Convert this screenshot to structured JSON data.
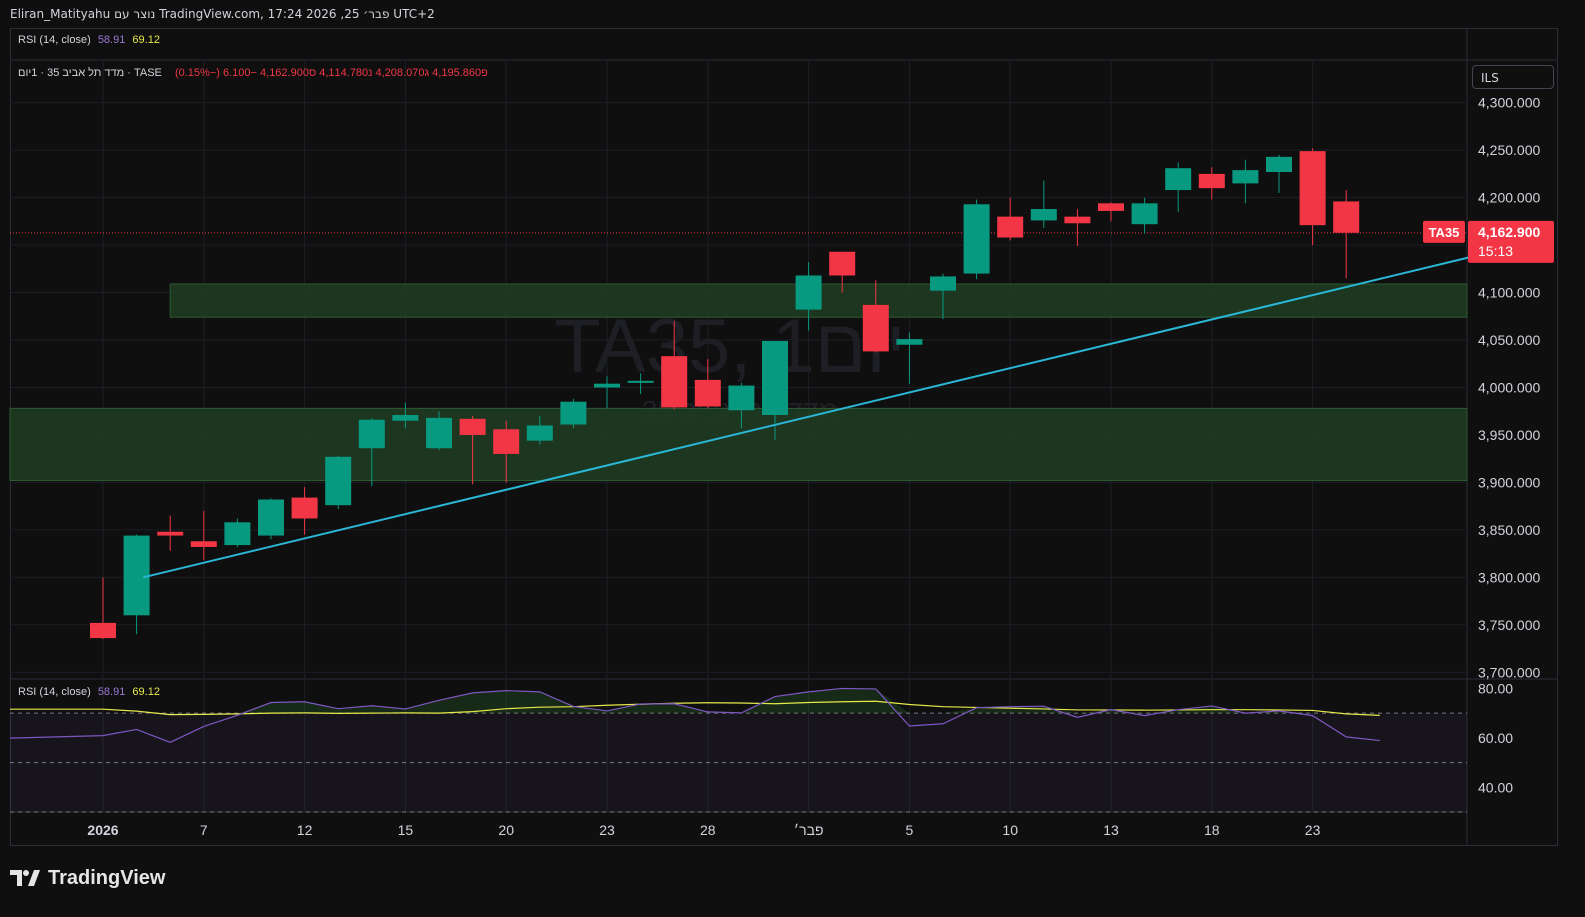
{
  "header": {
    "text": "Eliran_Matityahu נוצר עם TradingView.com, 17:24 2026 ,25 פבר׳ UTC+2"
  },
  "rsi_top_legend": {
    "label": "RSI (14, close)",
    "rsi": "58.91",
    "ma": "69.12"
  },
  "price_legend": {
    "symbol": "מדד תל אביב 35 · 1יום · TASE",
    "o_label": "פ",
    "o": "4,195.860",
    "h_label": "ג",
    "h": "4,208.070",
    "l_label": "נ",
    "l": "4,114.780",
    "c_label": "ס",
    "c": "4,162.900",
    "change": "−6.100 (−0.15%)"
  },
  "currency_button": "ILS",
  "watermark": {
    "title": "TA35, 1יום",
    "subtitle": "מדד תל אביב 35"
  },
  "price_tag": {
    "symbol": "TA35",
    "price": "4,162.900",
    "countdown": "15:13"
  },
  "rsi_panel_legend": {
    "label": "RSI (14, close)",
    "rsi": "58.91",
    "ma": "69.12"
  },
  "footer": {
    "brand": "TradingView"
  },
  "colors": {
    "up": "#089981",
    "down": "#f23645",
    "trendline": "#2ab7d6",
    "rsi": "#7e57c2",
    "rsi_ma": "#e6e94a",
    "zone": "#1f3d22"
  },
  "chart_data": {
    "type": "candlestick",
    "title": "TA35, 1יום",
    "price_axis": {
      "ticks": [
        "3,700.000",
        "3,750.000",
        "3,800.000",
        "3,850.000",
        "3,900.000",
        "3,950.000",
        "4,000.000",
        "4,050.000",
        "4,100.000",
        "4,150.000",
        "4,200.000",
        "4,250.000",
        "4,300.000"
      ],
      "range": [
        3695,
        4345
      ]
    },
    "time_axis": {
      "labels": [
        {
          "text": "2026",
          "idx": 0,
          "bold": true
        },
        {
          "text": "7",
          "idx": 3
        },
        {
          "text": "12",
          "idx": 6
        },
        {
          "text": "15",
          "idx": 9
        },
        {
          "text": "20",
          "idx": 12
        },
        {
          "text": "23",
          "idx": 15
        },
        {
          "text": "28",
          "idx": 18
        },
        {
          "text": "פבר׳",
          "idx": 21
        },
        {
          "text": "5",
          "idx": 24
        },
        {
          "text": "10",
          "idx": 27
        },
        {
          "text": "13",
          "idx": 30
        },
        {
          "text": "18",
          "idx": 33
        },
        {
          "text": "23",
          "idx": 36
        }
      ]
    },
    "candles": [
      {
        "o": 3752,
        "h": 3800,
        "l": 3735,
        "c": 3736
      },
      {
        "o": 3760,
        "h": 3845,
        "l": 3740,
        "c": 3844
      },
      {
        "o": 3848,
        "h": 3865,
        "l": 3828,
        "c": 3844
      },
      {
        "o": 3838,
        "h": 3870,
        "l": 3818,
        "c": 3832
      },
      {
        "o": 3834,
        "h": 3862,
        "l": 3832,
        "c": 3858
      },
      {
        "o": 3844,
        "h": 3883,
        "l": 3840,
        "c": 3882
      },
      {
        "o": 3884,
        "h": 3895,
        "l": 3845,
        "c": 3862
      },
      {
        "o": 3876,
        "h": 3928,
        "l": 3872,
        "c": 3927
      },
      {
        "o": 3936,
        "h": 3968,
        "l": 3896,
        "c": 3966
      },
      {
        "o": 3965,
        "h": 3984,
        "l": 3957,
        "c": 3971
      },
      {
        "o": 3936,
        "h": 3975,
        "l": 3934,
        "c": 3968
      },
      {
        "o": 3967,
        "h": 3970,
        "l": 3898,
        "c": 3950
      },
      {
        "o": 3956,
        "h": 3965,
        "l": 3900,
        "c": 3930
      },
      {
        "o": 3944,
        "h": 3970,
        "l": 3940,
        "c": 3960
      },
      {
        "o": 3961,
        "h": 3988,
        "l": 3957,
        "c": 3985
      },
      {
        "o": 4000,
        "h": 4012,
        "l": 3978,
        "c": 4004
      },
      {
        "o": 4005,
        "h": 4015,
        "l": 3993,
        "c": 4007
      },
      {
        "o": 4033,
        "h": 4070,
        "l": 3977,
        "c": 3979
      },
      {
        "o": 4008,
        "h": 4030,
        "l": 3978,
        "c": 3980
      },
      {
        "o": 3976,
        "h": 4005,
        "l": 3957,
        "c": 4002
      },
      {
        "o": 3971,
        "h": 4049,
        "l": 3945,
        "c": 4049
      },
      {
        "o": 4082,
        "h": 4132,
        "l": 4060,
        "c": 4118
      },
      {
        "o": 4143,
        "h": 4143,
        "l": 4100,
        "c": 4118
      },
      {
        "o": 4087,
        "h": 4113,
        "l": 4037,
        "c": 4038
      },
      {
        "o": 4045,
        "h": 4058,
        "l": 4004,
        "c": 4051
      },
      {
        "o": 4102,
        "h": 4120,
        "l": 4072,
        "c": 4117
      },
      {
        "o": 4120,
        "h": 4198,
        "l": 4114,
        "c": 4193
      },
      {
        "o": 4180,
        "h": 4200,
        "l": 4155,
        "c": 4158
      },
      {
        "o": 4176,
        "h": 4218,
        "l": 4168,
        "c": 4188
      },
      {
        "o": 4180,
        "h": 4188,
        "l": 4149,
        "c": 4173
      },
      {
        "o": 4194,
        "h": 4195,
        "l": 4175,
        "c": 4186
      },
      {
        "o": 4172,
        "h": 4200,
        "l": 4162,
        "c": 4194
      },
      {
        "o": 4208,
        "h": 4237,
        "l": 4185,
        "c": 4231
      },
      {
        "o": 4225,
        "h": 4232,
        "l": 4198,
        "c": 4210
      },
      {
        "o": 4215,
        "h": 4240,
        "l": 4194,
        "c": 4229
      },
      {
        "o": 4227,
        "h": 4245,
        "l": 4205,
        "c": 4243
      },
      {
        "o": 4249,
        "h": 4252,
        "l": 4150,
        "c": 4171
      },
      {
        "o": 4196,
        "h": 4208,
        "l": 4115,
        "c": 4163
      }
    ],
    "zones": [
      {
        "from": 3902,
        "to": 3978,
        "start_idx": -4
      },
      {
        "from": 4074,
        "to": 4109,
        "start_idx": 2
      }
    ],
    "trendline": {
      "start": {
        "idx": 1.2,
        "price": 3800
      },
      "end": {
        "idx": 41,
        "price": 4140
      }
    },
    "last_price_line": 4162.9,
    "rsi_axis": {
      "ticks": [
        "40.00",
        "60.00",
        "80.00"
      ],
      "range": [
        30,
        83
      ],
      "bands": [
        70,
        50,
        30
      ]
    },
    "rsi": [
      60.9,
      63.4,
      58.2,
      64.6,
      69.1,
      74.3,
      74.6,
      71.8,
      73.0,
      71.7,
      75.2,
      78.2,
      79.1,
      78.6,
      72.7,
      70.9,
      73.7,
      73.8,
      70.5,
      70.1,
      76.7,
      78.6,
      80.0,
      79.8,
      64.8,
      65.7,
      72.2,
      72.6,
      72.8,
      68.3,
      71.4,
      69.0,
      71.4,
      72.9,
      70.0,
      70.9,
      69.0,
      60.4,
      58.9
    ],
    "rsi_ma": [
      71.6,
      70.8,
      69.4,
      69.5,
      69.7,
      70.0,
      70.1,
      69.9,
      70.0,
      70.1,
      70.0,
      70.6,
      71.8,
      72.4,
      72.6,
      73.2,
      73.6,
      74.0,
      74.2,
      74.1,
      73.8,
      74.3,
      74.6,
      74.8,
      73.5,
      72.6,
      72.3,
      72.0,
      71.7,
      71.3,
      71.3,
      71.2,
      71.3,
      71.4,
      71.4,
      71.3,
      71.1,
      69.7,
      69.1
    ]
  }
}
